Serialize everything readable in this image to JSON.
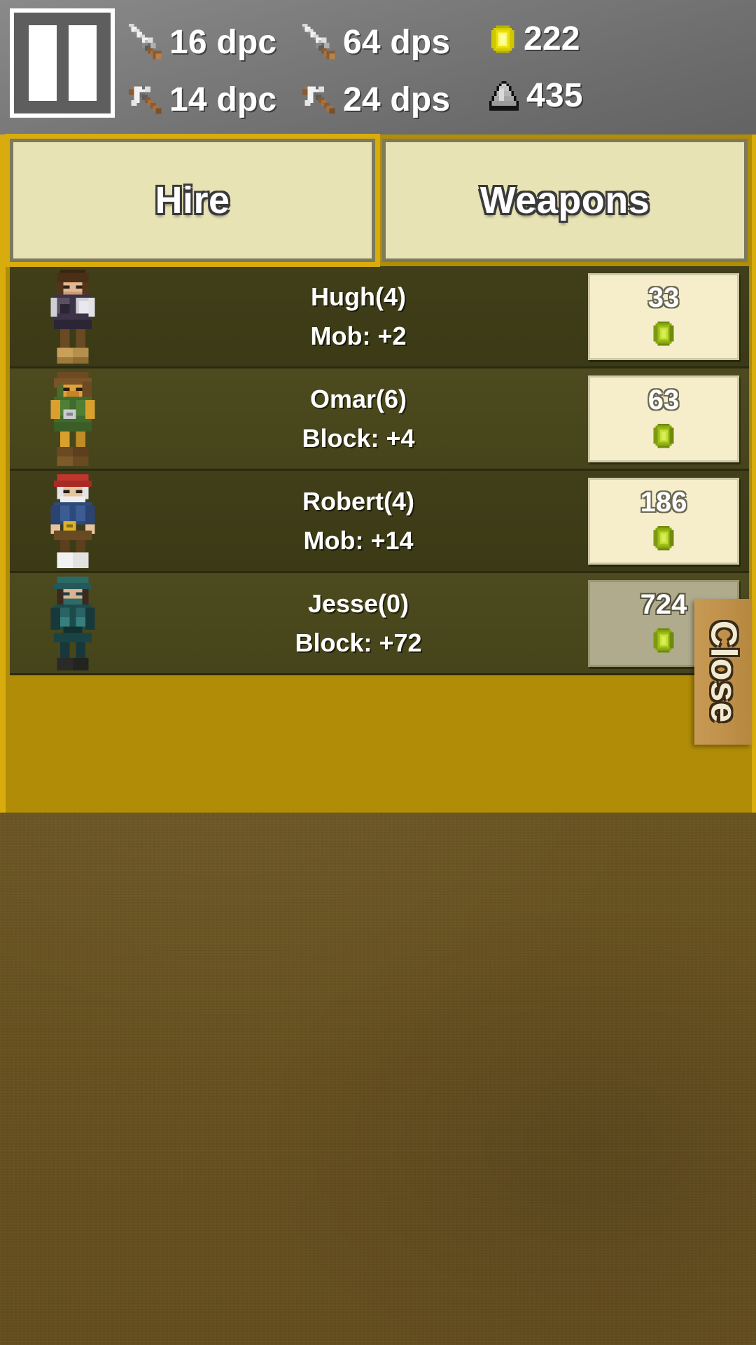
{
  "hud": {
    "pause_button_label": "Pause",
    "stats": [
      {
        "icon": "sword-icon",
        "value": "16 dpc"
      },
      {
        "icon": "pickaxe-icon",
        "value": "14 dpc"
      },
      {
        "icon": "sword-icon",
        "value": "64 dps"
      },
      {
        "icon": "pickaxe-icon",
        "value": "24 dps"
      },
      {
        "icon": "gold-gem-icon",
        "value": "222"
      },
      {
        "icon": "stone-icon",
        "value": "435"
      }
    ]
  },
  "tabs": [
    {
      "label": "Hire",
      "selected": true
    },
    {
      "label": "Weapons",
      "selected": false
    }
  ],
  "hire_list": [
    {
      "name": "Hugh(4)",
      "bonus": "Mob: +2",
      "price": "33",
      "currency": "emerald-icon",
      "affordable": true,
      "avatar": "miner-brown-hair"
    },
    {
      "name": "Omar(6)",
      "bonus": "Block: +4",
      "price": "63",
      "currency": "emerald-icon",
      "affordable": true,
      "avatar": "explorer-green"
    },
    {
      "name": "Robert(4)",
      "bonus": "Mob: +14",
      "price": "186",
      "currency": "emerald-icon",
      "affordable": true,
      "avatar": "sailor-red-cap"
    },
    {
      "name": "Jesse(0)",
      "bonus": "Block: +72",
      "price": "724",
      "currency": "emerald-icon",
      "affordable": false,
      "avatar": "ranger-teal"
    }
  ],
  "close_button": {
    "label": "Close"
  },
  "colors": {
    "panel_border": "#d8ac0d",
    "panel_fill": "#b08c07",
    "tab_face": "#e8e3b4",
    "row_odd": "#3e3d18",
    "row_even": "#4c4a1e",
    "price_face": "#f6eecb",
    "price_disabled": "#b1ab8d",
    "close_face": "#bf9049",
    "hud_gray": "#7b7b7b",
    "dirt": "#6b5421",
    "emerald_green": "#9bbd16",
    "gold_gem": "#e8e00a"
  }
}
